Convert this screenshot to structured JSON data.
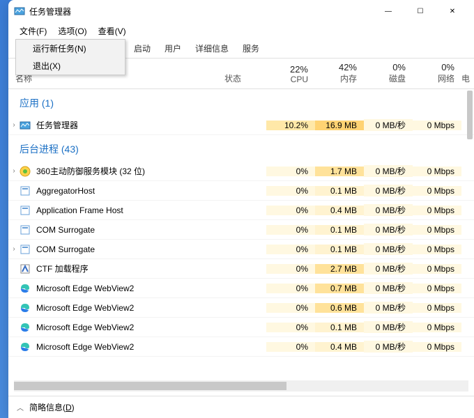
{
  "window": {
    "title": "任务管理器"
  },
  "winbuttons": {
    "min": "—",
    "max": "☐",
    "close": "✕"
  },
  "menubar": [
    "文件(F)",
    "选项(O)",
    "查看(V)"
  ],
  "dropdown": [
    "运行新任务(N)",
    "退出(X)"
  ],
  "tabs": [
    "启动",
    "用户",
    "详细信息",
    "服务"
  ],
  "columns": {
    "name": "名称",
    "status": "状态",
    "cpu": {
      "pct": "22%",
      "label": "CPU"
    },
    "mem": {
      "pct": "42%",
      "label": "内存"
    },
    "disk": {
      "pct": "0%",
      "label": "磁盘"
    },
    "net": {
      "pct": "0%",
      "label": "网络"
    },
    "extra": "电"
  },
  "groups": {
    "apps": {
      "label": "应用 (1)"
    },
    "bg": {
      "label": "后台进程 (43)"
    }
  },
  "processes": [
    {
      "group": "apps",
      "expandable": true,
      "icon": "taskmgr",
      "name": "任务管理器",
      "cpu": "10.2%",
      "cpuHeat": 1,
      "mem": "16.9 MB",
      "memHeat": 2,
      "disk": "0 MB/秒",
      "net": "0 Mbps"
    },
    {
      "group": "bg",
      "expandable": true,
      "icon": "360",
      "name": "360主动防御服务模块 (32 位)",
      "cpu": "0%",
      "cpuHeat": 0,
      "mem": "1.7 MB",
      "memHeat": 1,
      "disk": "0 MB/秒",
      "net": "0 Mbps"
    },
    {
      "group": "bg",
      "expandable": false,
      "icon": "generic",
      "name": "AggregatorHost",
      "cpu": "0%",
      "cpuHeat": 0,
      "mem": "0.1 MB",
      "memHeat": 0,
      "disk": "0 MB/秒",
      "net": "0 Mbps"
    },
    {
      "group": "bg",
      "expandable": false,
      "icon": "generic",
      "name": "Application Frame Host",
      "cpu": "0%",
      "cpuHeat": 0,
      "mem": "0.4 MB",
      "memHeat": 0,
      "disk": "0 MB/秒",
      "net": "0 Mbps"
    },
    {
      "group": "bg",
      "expandable": false,
      "icon": "generic",
      "name": "COM Surrogate",
      "cpu": "0%",
      "cpuHeat": 0,
      "mem": "0.1 MB",
      "memHeat": 0,
      "disk": "0 MB/秒",
      "net": "0 Mbps"
    },
    {
      "group": "bg",
      "expandable": true,
      "icon": "generic",
      "name": "COM Surrogate",
      "cpu": "0%",
      "cpuHeat": 0,
      "mem": "0.1 MB",
      "memHeat": 0,
      "disk": "0 MB/秒",
      "net": "0 Mbps"
    },
    {
      "group": "bg",
      "expandable": false,
      "icon": "ctf",
      "name": "CTF 加载程序",
      "cpu": "0%",
      "cpuHeat": 0,
      "mem": "2.7 MB",
      "memHeat": 1,
      "disk": "0 MB/秒",
      "net": "0 Mbps"
    },
    {
      "group": "bg",
      "expandable": false,
      "icon": "edge",
      "name": "Microsoft Edge WebView2",
      "cpu": "0%",
      "cpuHeat": 0,
      "mem": "0.7 MB",
      "memHeat": 1,
      "disk": "0 MB/秒",
      "net": "0 Mbps"
    },
    {
      "group": "bg",
      "expandable": false,
      "icon": "edge",
      "name": "Microsoft Edge WebView2",
      "cpu": "0%",
      "cpuHeat": 0,
      "mem": "0.6 MB",
      "memHeat": 1,
      "disk": "0 MB/秒",
      "net": "0 Mbps"
    },
    {
      "group": "bg",
      "expandable": false,
      "icon": "edge",
      "name": "Microsoft Edge WebView2",
      "cpu": "0%",
      "cpuHeat": 0,
      "mem": "0.1 MB",
      "memHeat": 0,
      "disk": "0 MB/秒",
      "net": "0 Mbps"
    },
    {
      "group": "bg",
      "expandable": false,
      "icon": "edge",
      "name": "Microsoft Edge WebView2",
      "cpu": "0%",
      "cpuHeat": 0,
      "mem": "0.4 MB",
      "memHeat": 0,
      "disk": "0 MB/秒",
      "net": "0 Mbps"
    }
  ],
  "footer": {
    "label_prefix": "简略信息(",
    "label_ul": "D",
    "label_suffix": ")"
  },
  "icons": {
    "taskmgr": "<svg viewBox='0 0 16 16'><rect x='1' y='3' width='14' height='10' fill='#4aa3df' stroke='#2a6aa0'/><polyline points='2,10 5,6 8,9 11,5 14,8' fill='none' stroke='#fff' stroke-width='1'/></svg>",
    "360": "<svg viewBox='0 0 16 16'><circle cx='8' cy='8' r='7' fill='#ffd24a' stroke='#d4a017'/><circle cx='8' cy='8' r='3' fill='#5fbf3f'/></svg>",
    "generic": "<svg viewBox='0 0 16 16'><rect x='2' y='2' width='12' height='12' fill='#fff' stroke='#6aa0d8'/><rect x='4' y='4' width='8' height='2' fill='#6aa0d8'/></svg>",
    "ctf": "<svg viewBox='0 0 16 16'><rect x='2' y='2' width='12' height='12' fill='#fff' stroke='#888'/><path d='M4 12 L8 4 L12 12' fill='none' stroke='#3a6fc4' stroke-width='2'/></svg>",
    "edge": "<svg viewBox='0 0 16 16'><path d='M2 8 Q2 2 8 2 Q14 2 14 8 Q14 10 11 10 Q8 10 8 8' fill='#33c4b5'/><path d='M2 8 Q2 14 8 14 Q12 14 13 11' fill='#2b7de9'/></svg>"
  }
}
